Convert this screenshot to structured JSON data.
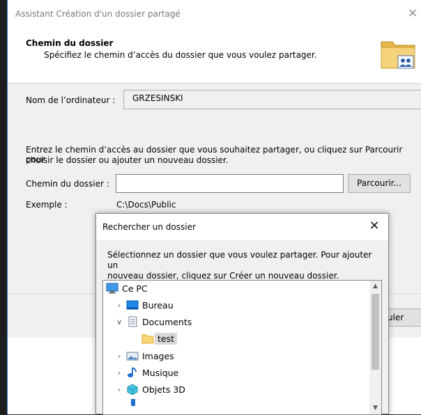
{
  "wizard": {
    "title": "Assistant Création d'un dossier partagé",
    "close": "×",
    "header_title": "Chemin du dossier",
    "header_subtitle": "Spécifiez le chemin d’accès du dossier que vous voulez partager.",
    "computer_label": "Nom de l’ordinateur :",
    "computer_name": "GRZESINSKI",
    "instructions_line1": "Entrez le chemin d’accès au dossier que vous souhaitez partager, ou cliquez sur Parcourir pour",
    "instructions_line2": "choisir le dossier ou ajouter un nouveau dossier.",
    "path_label": "Chemin du dossier :",
    "path_value": "",
    "browse_button": "Parcourir...",
    "example_label": "Exemple :",
    "example_value": "C:\\Docs\\Public",
    "cancel_button": "uler"
  },
  "dialog": {
    "title": "Rechercher un dossier",
    "close": "×",
    "description_line1": "Sélectionnez un dossier que vous voulez partager. Pour ajouter un",
    "description_line2": "nouveau dossier, cliquez sur Créer un nouveau dossier.",
    "tree": [
      {
        "label": "Ce PC",
        "icon": "computer-icon",
        "expanded": true
      },
      {
        "label": "Bureau",
        "icon": "desktop-folder-icon",
        "expanded": false
      },
      {
        "label": "Documents",
        "icon": "documents-folder-icon",
        "expanded": true
      },
      {
        "label": "test",
        "icon": "folder-icon",
        "selected": true
      },
      {
        "label": "Images",
        "icon": "pictures-folder-icon",
        "expanded": false
      },
      {
        "label": "Musique",
        "icon": "music-folder-icon",
        "expanded": false
      },
      {
        "label": "Objets 3D",
        "icon": "3d-objects-folder-icon",
        "expanded": false
      }
    ]
  },
  "colors": {
    "selection": "#d9d9d9",
    "window_bg": "#f0f0f0",
    "accent": "#3a78c9"
  }
}
